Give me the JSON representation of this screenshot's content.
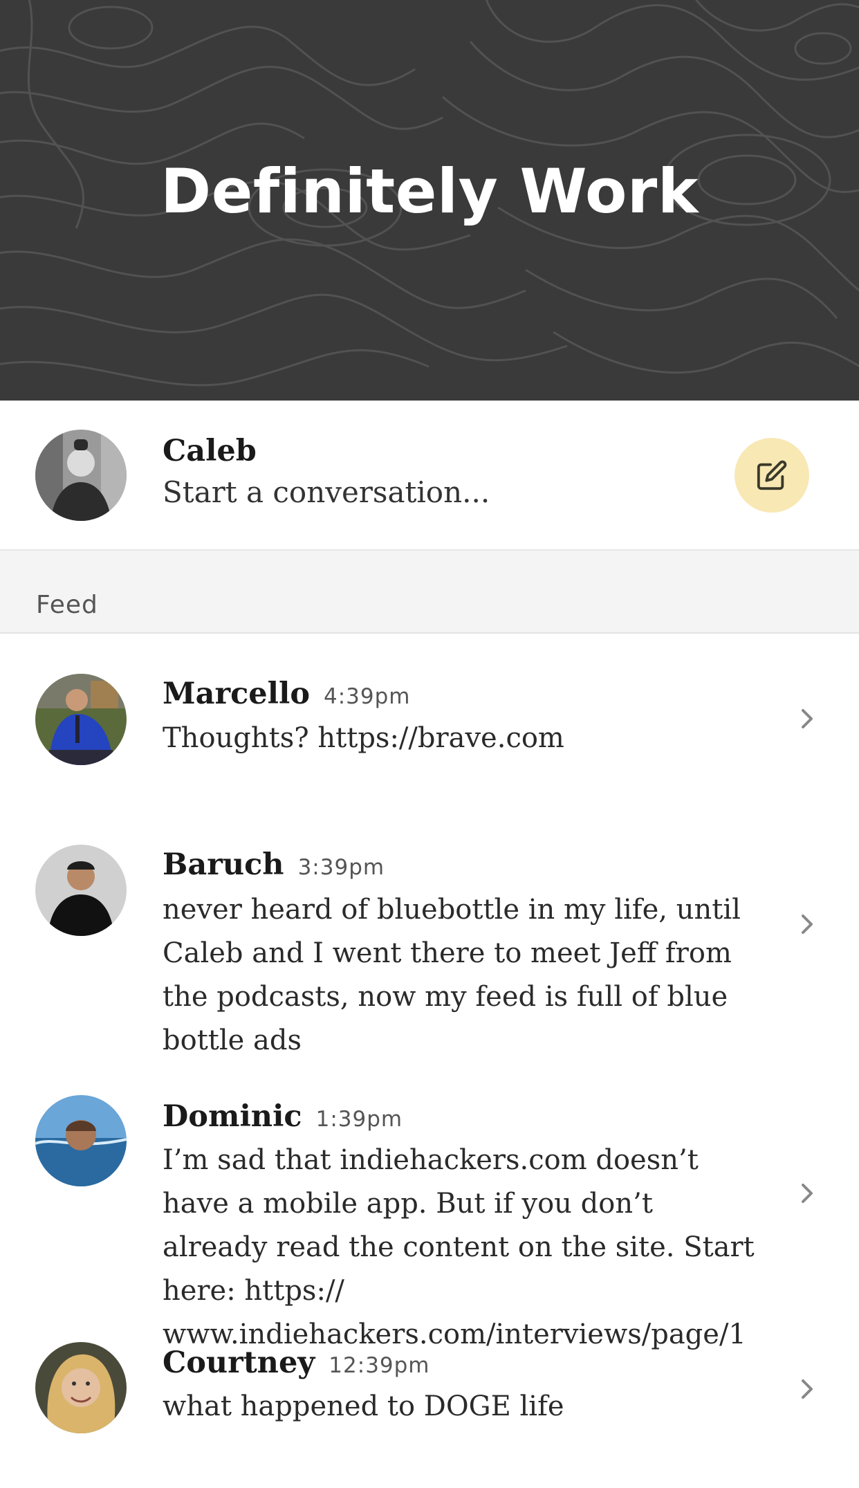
{
  "header": {
    "title": "Definitely Work"
  },
  "composer": {
    "user_name": "Caleb",
    "placeholder": "Start a conversation...",
    "compose_icon": "edit-icon"
  },
  "feed": {
    "label": "Feed",
    "items": [
      {
        "author": "Marcello",
        "time": "4:39pm",
        "message": "Thoughts? https://brave.com"
      },
      {
        "author": "Baruch",
        "time": "3:39pm",
        "message": "never heard of bluebottle in my life, until Caleb and I went there to meet Jeff from the podcasts, now my feed is full of blue bottle ads"
      },
      {
        "author": "Dominic",
        "time": "1:39pm",
        "message": "I’m sad that indiehackers.com doesn’t have a mobile app. But if you don’t already read the content on the site. Start here: https:// www.indiehackers.com/interviews/page/1"
      },
      {
        "author": "Courtney",
        "time": "12:39pm",
        "message": "what happened to DOGE life"
      }
    ]
  },
  "colors": {
    "header_bg": "#3a3a3a",
    "compose_button_bg": "#f8e8b4",
    "feed_label_bg": "#f4f4f4"
  }
}
